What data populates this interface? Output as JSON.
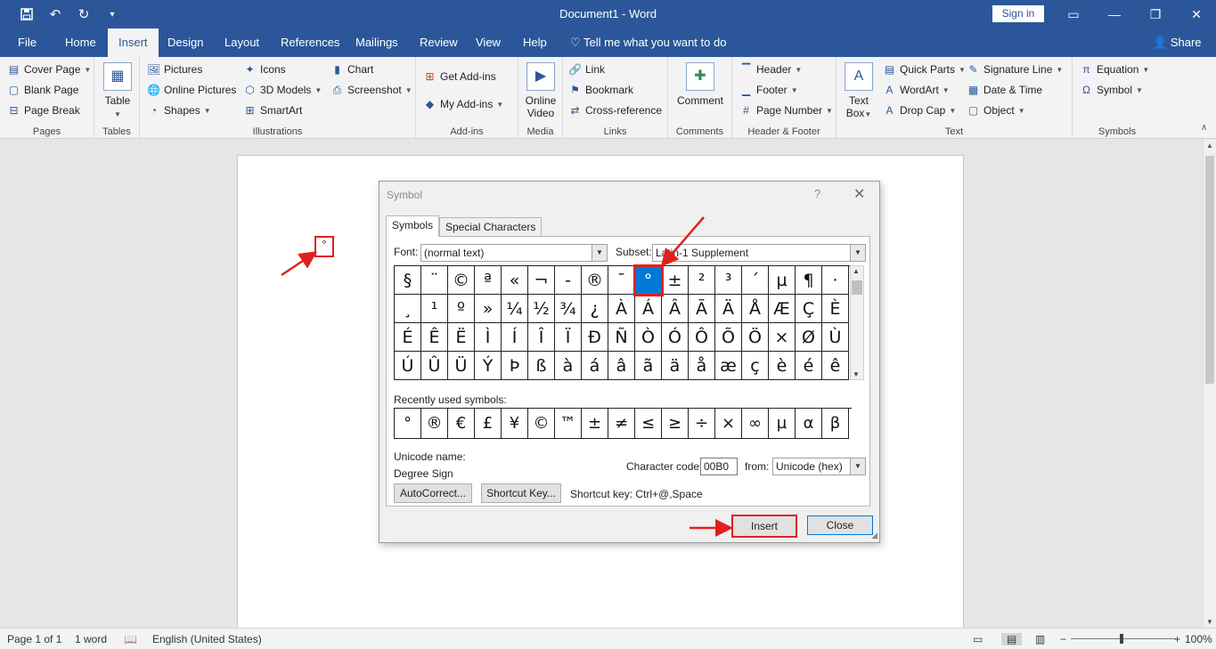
{
  "app": {
    "title": "Document1  -  Word",
    "signin_label": "Sign in",
    "share_label": "Share",
    "tellme": "Tell me what you want to do"
  },
  "tabs": [
    "File",
    "Home",
    "Insert",
    "Design",
    "Layout",
    "References",
    "Mailings",
    "Review",
    "View",
    "Help"
  ],
  "ribbon": {
    "pages": {
      "label": "Pages",
      "cover_page": "Cover Page",
      "blank_page": "Blank Page",
      "page_break": "Page Break"
    },
    "tables": {
      "label": "Tables",
      "table": "Table"
    },
    "illustrations": {
      "label": "Illustrations",
      "pictures": "Pictures",
      "online_pictures": "Online Pictures",
      "shapes": "Shapes",
      "icons": "Icons",
      "models": "3D Models",
      "smartart": "SmartArt",
      "chart": "Chart",
      "screenshot": "Screenshot"
    },
    "addins": {
      "label": "Add-ins",
      "get": "Get Add-ins",
      "my": "My Add-ins"
    },
    "media": {
      "label": "Media",
      "online_video_1": "Online",
      "online_video_2": "Video"
    },
    "links": {
      "label": "Links",
      "link": "Link",
      "bookmark": "Bookmark",
      "crossref": "Cross-reference"
    },
    "comments": {
      "label": "Comments",
      "comment": "Comment"
    },
    "header_footer": {
      "label": "Header & Footer",
      "header": "Header",
      "footer": "Footer",
      "page_number": "Page Number"
    },
    "text": {
      "label": "Text",
      "textbox_1": "Text",
      "textbox_2": "Box",
      "quick_parts": "Quick Parts",
      "wordart": "WordArt",
      "drop_cap": "Drop Cap",
      "signature": "Signature Line",
      "datetime": "Date & Time",
      "object": "Object"
    },
    "symbols": {
      "label": "Symbols",
      "equation": "Equation",
      "symbol": "Symbol"
    }
  },
  "document": {
    "inserted_char": "°"
  },
  "dialog": {
    "title": "Symbol",
    "help": "?",
    "tab_symbols": "Symbols",
    "tab_special": "Special Characters",
    "font_label": "Font:",
    "font_value": "(normal text)",
    "subset_label": "Subset:",
    "subset_value": "Latin-1 Supplement",
    "symbols": [
      "§",
      "¨",
      "©",
      "ª",
      "«",
      "¬",
      "-",
      "®",
      "¯",
      "°",
      "±",
      "²",
      "³",
      "´",
      "µ",
      "¶",
      "·",
      "¸",
      "¹",
      "º",
      "»",
      "¼",
      "½",
      "¾",
      "¿",
      "À",
      "Á",
      "Â",
      "Ã",
      "Ä",
      "Å",
      "Æ",
      "Ç",
      "È",
      "É",
      "Ê",
      "Ë",
      "Ì",
      "Í",
      "Î",
      "Ï",
      "Ð",
      "Ñ",
      "Ò",
      "Ó",
      "Ô",
      "Õ",
      "Ö",
      "×",
      "Ø",
      "Ù",
      "Ú",
      "Û",
      "Ü",
      "Ý",
      "Þ",
      "ß",
      "à",
      "á",
      "â",
      "ã",
      "ä",
      "å",
      "æ",
      "ç",
      "è",
      "é",
      "ê"
    ],
    "selected_index": 9,
    "recent_label": "Recently used symbols:",
    "recent": [
      "°",
      "®",
      "€",
      "£",
      "¥",
      "©",
      "™",
      "±",
      "≠",
      "≤",
      "≥",
      "÷",
      "×",
      "∞",
      "µ",
      "α",
      "β"
    ],
    "unicode_name_label": "Unicode name:",
    "unicode_name": "Degree Sign",
    "char_code_label": "Character code:",
    "char_code": "00B0",
    "from_label": "from:",
    "from_value": "Unicode (hex)",
    "autocorrect": "AutoCorrect...",
    "shortcut_btn": "Shortcut Key...",
    "shortcut_text": "Shortcut key: Ctrl+@,Space",
    "insert": "Insert",
    "close": "Close"
  },
  "status": {
    "page": "Page 1 of 1",
    "words": "1 word",
    "language": "English (United States)",
    "zoom": "100%"
  },
  "colors": {
    "brand": "#2b579a",
    "annotation": "#e02020",
    "selection": "#0078d7"
  }
}
